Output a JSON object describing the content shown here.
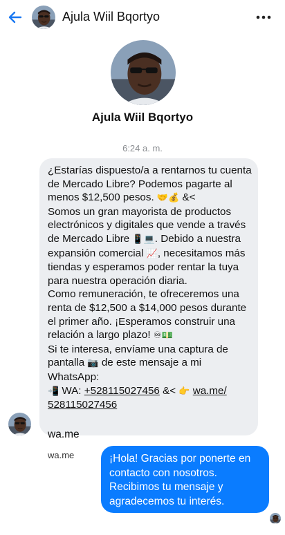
{
  "header": {
    "contact_name": "Ajula Wiil Bqortyo",
    "back_icon": "back-arrow-icon",
    "more_icon": "more-options-icon",
    "accent": "#1877f2"
  },
  "profile": {
    "name": "Ajula Wiil Bqortyo"
  },
  "thread": {
    "timestamp": "6:24 a. m.",
    "incoming": {
      "l1": "¿Estarías dispuesto/a a rentarnos tu cuenta",
      "l2": "de Mercado Libre? Podemos pagarte al",
      "l3a": "menos $12,500 pesos. ",
      "l3b": "🤝💰",
      "l3c": " &<",
      "l4": "Somos un gran mayorista de productos",
      "l5": "electrónicos y digitales que vende a través",
      "l6a": "de Mercado Libre ",
      "l6b": "📱💻",
      "l6c": ". Debido a nuestra",
      "l7a": "expansión comercial ",
      "l7b": "📈",
      "l7c": ", necesitamos más",
      "l8": "tiendas y esperamos poder rentar la tuya",
      "l9": "para nuestra operación diaria.",
      "l10": "Como remuneración, te ofreceremos una",
      "l11": "renta de $12,500 a $14,000 pesos durante",
      "l12": "el primer año. ¡Esperamos construir una",
      "l13a": "relación a largo plazo! ",
      "l13b": "♾💵",
      "l14": "Si te interesa, envíame una captura de",
      "l15a": "pantalla ",
      "l15b": "📷",
      "l15c": " de este mensaje a mi",
      "l16": "WhatsApp:",
      "l17a": "📲",
      "l17b": " WA: ",
      "l17c": "+528115027456",
      "l17d": " &< ",
      "l17e": "👉",
      "l17f": " ",
      "l17g": "wa.me/",
      "l18": "528115027456",
      "preview_title": "wa.me",
      "preview_domain": "wa.me"
    },
    "outgoing": {
      "l1": "¡Hola! Gracias por ponerte en",
      "l2": "contacto con nosotros.",
      "l3": "Recibimos tu mensaje y",
      "l4": "agradecemos tu interés."
    }
  },
  "colors": {
    "incoming_bubble": "#eceef1",
    "outgoing_bubble": "#0a7cff",
    "timestamp_text": "#8a8d91"
  }
}
